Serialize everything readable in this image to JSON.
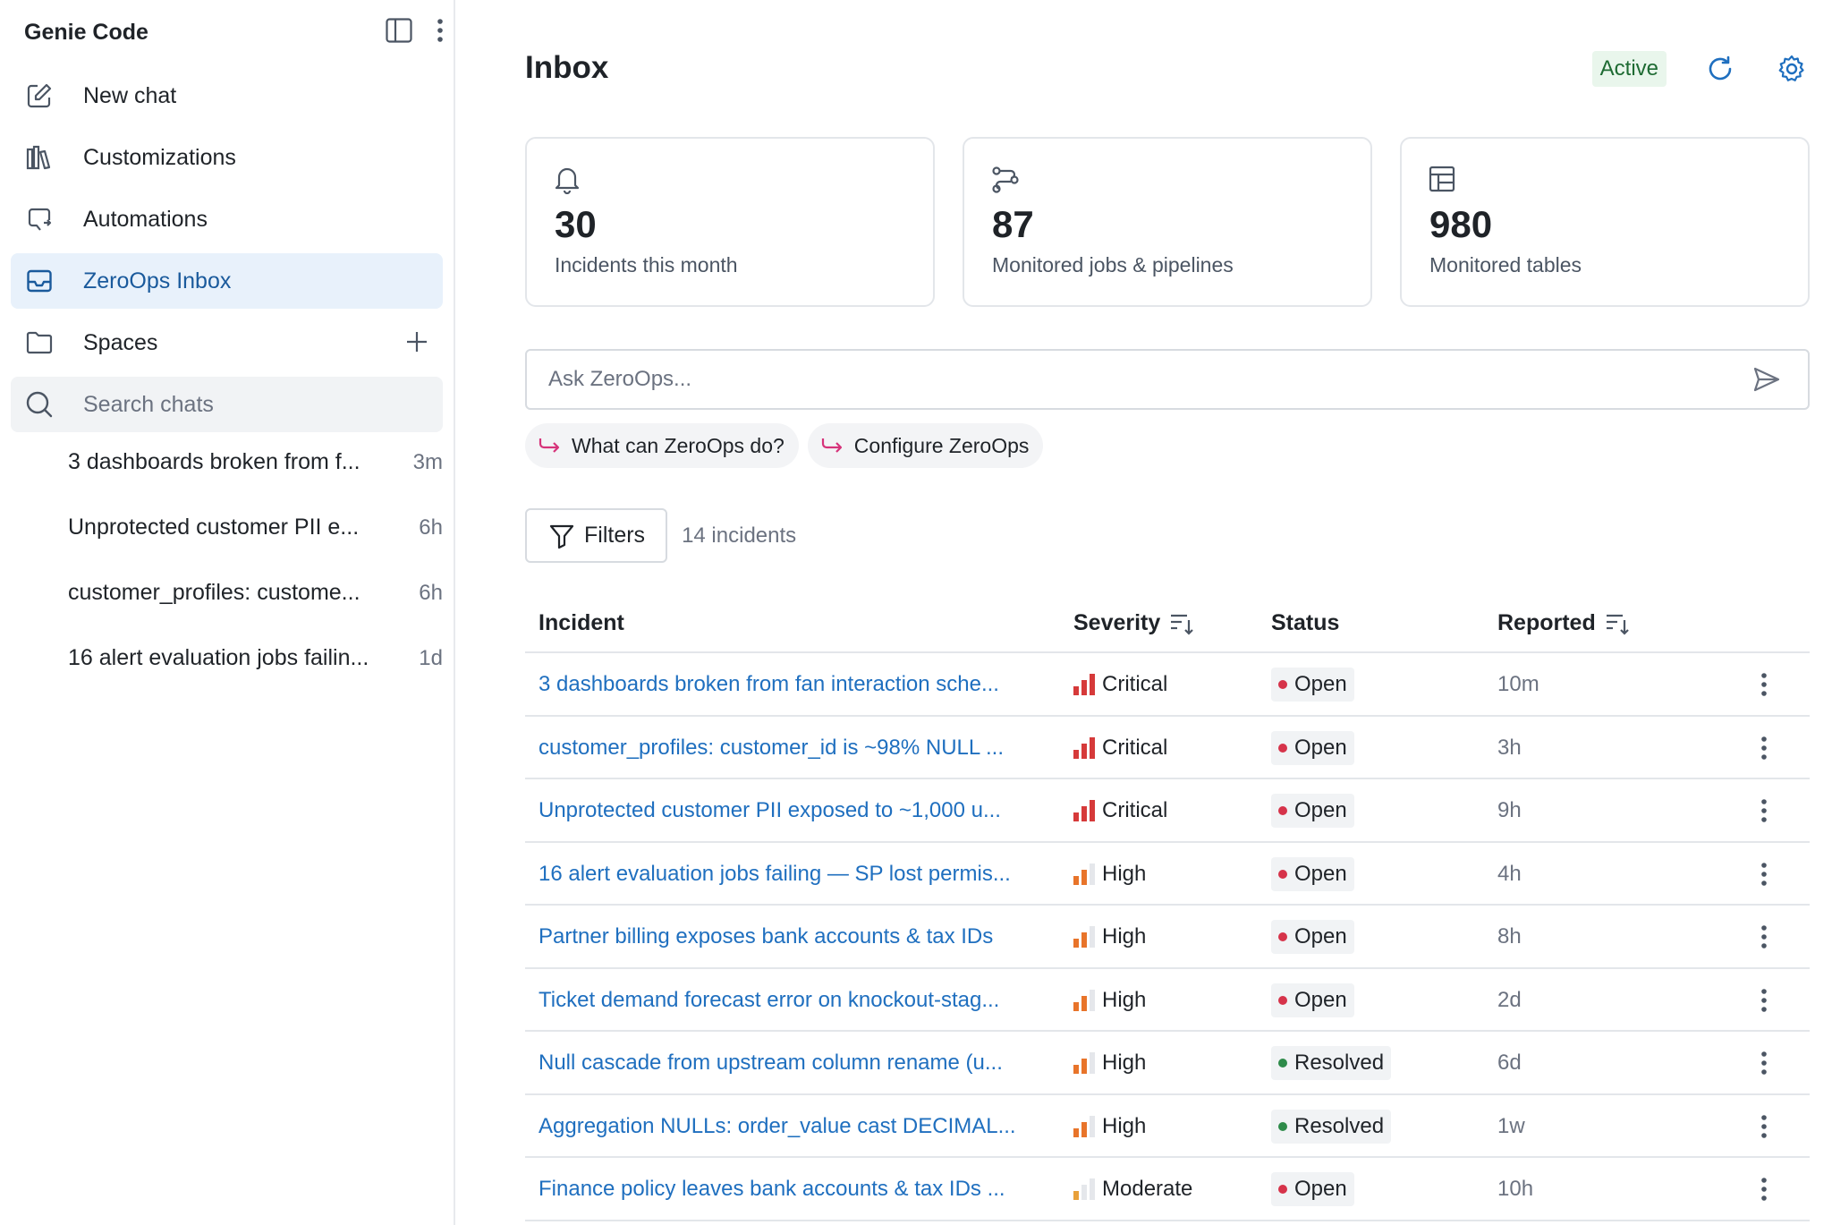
{
  "sidebar": {
    "title": "Genie Code",
    "nav": [
      {
        "label": "New chat",
        "icon": "edit-icon"
      },
      {
        "label": "Customizations",
        "icon": "library-icon"
      },
      {
        "label": "Automations",
        "icon": "automation-icon"
      },
      {
        "label": "ZeroOps Inbox",
        "icon": "inbox-icon",
        "active": true
      },
      {
        "label": "Spaces",
        "icon": "folder-icon"
      }
    ],
    "search_placeholder": "Search chats",
    "chats": [
      {
        "title": "3 dashboards broken from f...",
        "age": "3m"
      },
      {
        "title": "Unprotected customer PII e...",
        "age": "6h"
      },
      {
        "title": "customer_profiles: custome...",
        "age": "6h"
      },
      {
        "title": "16 alert evaluation jobs failin...",
        "age": "1d"
      }
    ]
  },
  "header": {
    "title": "Inbox",
    "status": "Active"
  },
  "stats": [
    {
      "value": "30",
      "label": "Incidents this month",
      "icon": "bell-icon"
    },
    {
      "value": "87",
      "label": "Monitored jobs & pipelines",
      "icon": "pipeline-icon"
    },
    {
      "value": "980",
      "label": "Monitored tables",
      "icon": "table-icon"
    }
  ],
  "ask": {
    "placeholder": "Ask ZeroOps..."
  },
  "suggestions": [
    "What can ZeroOps do?",
    "Configure ZeroOps"
  ],
  "filters": {
    "label": "Filters",
    "count": "14 incidents"
  },
  "table": {
    "columns": {
      "incident": "Incident",
      "severity": "Severity",
      "status": "Status",
      "reported": "Reported"
    },
    "rows": [
      {
        "incident": "3 dashboards broken from fan interaction sche...",
        "severity": "Critical",
        "status": "Open",
        "reported": "10m"
      },
      {
        "incident": "customer_profiles: customer_id is ~98% NULL ...",
        "severity": "Critical",
        "status": "Open",
        "reported": "3h"
      },
      {
        "incident": "Unprotected customer PII exposed to ~1,000 u...",
        "severity": "Critical",
        "status": "Open",
        "reported": "9h"
      },
      {
        "incident": "16 alert evaluation jobs failing — SP lost permis...",
        "severity": "High",
        "status": "Open",
        "reported": "4h"
      },
      {
        "incident": "Partner billing exposes bank accounts & tax IDs",
        "severity": "High",
        "status": "Open",
        "reported": "8h"
      },
      {
        "incident": "Ticket demand forecast error on knockout-stag...",
        "severity": "High",
        "status": "Open",
        "reported": "2d"
      },
      {
        "incident": "Null cascade from upstream column rename (u...",
        "severity": "High",
        "status": "Resolved",
        "reported": "6d"
      },
      {
        "incident": "Aggregation NULLs: order_value cast DECIMAL...",
        "severity": "High",
        "status": "Resolved",
        "reported": "1w"
      },
      {
        "incident": "Finance policy leaves bank accounts & tax IDs ...",
        "severity": "Moderate",
        "status": "Open",
        "reported": "10h"
      }
    ]
  },
  "colors": {
    "link": "#1f6fbf",
    "critical": "#d63a3a",
    "high": "#e8742a",
    "moderate": "#e8a03a",
    "open_dot": "#d6334a",
    "resolved_dot": "#2e8b4a",
    "active_nav_bg": "#e8f1fb"
  }
}
